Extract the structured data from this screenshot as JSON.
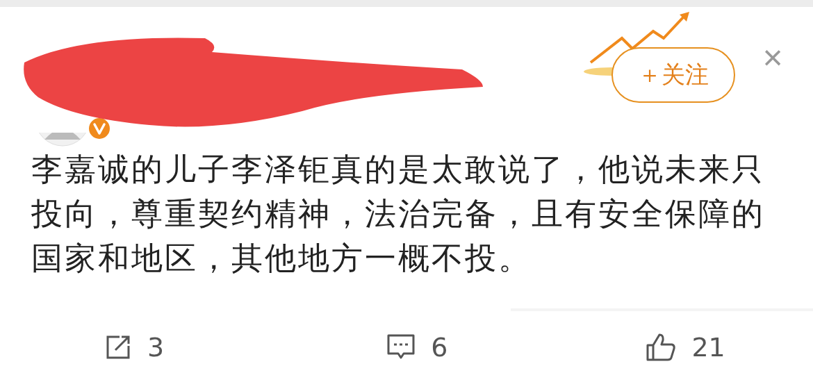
{
  "header": {
    "follow_button": "＋关注",
    "close": "×"
  },
  "post": {
    "text": "李嘉诚的儿子李泽钜真的是太敢说了，他说未来只投向，尊重契约精神，法治完备，且有安全保障的国家和地区，其他地方一概不投。"
  },
  "actions": [
    {
      "kind": "share",
      "count": "3"
    },
    {
      "kind": "comment",
      "count": "6"
    },
    {
      "kind": "like",
      "count": "21"
    }
  ]
}
